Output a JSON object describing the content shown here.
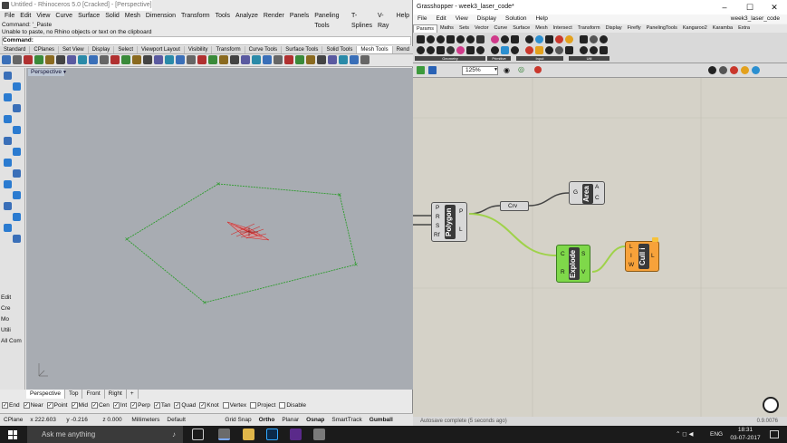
{
  "rhino": {
    "title": "Untitled - Rhinoceros 5.0 [Cracked] - [Perspective]",
    "menu": [
      "File",
      "Edit",
      "View",
      "Curve",
      "Surface",
      "Solid",
      "Mesh",
      "Dimension",
      "Transform",
      "Tools",
      "Analyze",
      "Render",
      "Panels",
      "Paneling Tools",
      "T-Splines",
      "V-Ray",
      "Help"
    ],
    "command_history": [
      "Command: '_Paste",
      "Unable to paste, no Rhino objects or text on the clipboard"
    ],
    "command_prompt": "Command:",
    "toolbar_tabs": [
      "Standard",
      "CPlanes",
      "Set View",
      "Display",
      "Select",
      "Viewport Layout",
      "Visibility",
      "Transform",
      "Curve Tools",
      "Surface Tools",
      "Solid Tools",
      "Mesh Tools",
      "Rend"
    ],
    "active_toolbar_tab": "Mesh Tools",
    "viewport_title": "Perspective",
    "sidebar_items": [
      "Edit",
      "Cre",
      "Mo",
      "Utili",
      "All Com"
    ],
    "viewport_tabs": [
      "Perspective",
      "Top",
      "Front",
      "Right",
      "+"
    ],
    "osnaps": [
      {
        "label": "End",
        "checked": true
      },
      {
        "label": "Near",
        "checked": true
      },
      {
        "label": "Point",
        "checked": true
      },
      {
        "label": "Mid",
        "checked": true
      },
      {
        "label": "Cen",
        "checked": true
      },
      {
        "label": "Int",
        "checked": true
      },
      {
        "label": "Perp",
        "checked": true
      },
      {
        "label": "Tan",
        "checked": true
      },
      {
        "label": "Quad",
        "checked": true
      },
      {
        "label": "Knot",
        "checked": true
      },
      {
        "label": "Vertex",
        "checked": false
      },
      {
        "label": "Project",
        "checked": false
      },
      {
        "label": "Disable",
        "checked": false
      }
    ],
    "status": {
      "cplane": "CPlane",
      "x": "x 222.603",
      "y": "y -0.216",
      "z": "z 0.000",
      "units": "Millimeters",
      "layer": "Default",
      "grid_snap": "Grid Snap",
      "ortho": "Ortho",
      "planar": "Planar",
      "osnap": "Osnap",
      "smarttrack": "SmartTrack",
      "gumball": "Gumball"
    },
    "colors": {
      "viewport_bg": "#a8acb2",
      "curve": "#2e9c2e",
      "grid": "#d22a2a"
    }
  },
  "grasshopper": {
    "title": "Grasshopper - week3_laser_code*",
    "menu": [
      "File",
      "Edit",
      "View",
      "Display",
      "Solution",
      "Help"
    ],
    "document": "week3_laser_code",
    "tabs": [
      "Params",
      "Maths",
      "Sets",
      "Vector",
      "Curve",
      "Surface",
      "Mesh",
      "Intersect",
      "Transform",
      "Display",
      "Firefly",
      "PanelingTools",
      "Kangaroo2",
      "Karamba",
      "Extra"
    ],
    "active_tab": "Params",
    "ribbon_groups": [
      "Geometry",
      "Primitive",
      "Input",
      "Util"
    ],
    "zoom": "125%",
    "components": {
      "polygon": {
        "name": "Polygon",
        "inputs": [
          "P",
          "R",
          "S",
          "Rf"
        ],
        "outputs": [
          "P",
          "L"
        ]
      },
      "crv": {
        "name": "Crv"
      },
      "area": {
        "name": "Area",
        "inputs": [
          "G"
        ],
        "outputs": [
          "A",
          "C"
        ]
      },
      "explode": {
        "name": "Explode",
        "inputs": [
          "C",
          "R"
        ],
        "outputs": [
          "S",
          "V"
        ]
      },
      "cull": {
        "name": "Cull i",
        "inputs": [
          "L",
          "I",
          "W"
        ],
        "outputs": [
          "L"
        ]
      }
    },
    "status": "Autosave complete (5 seconds ago)",
    "version": "0.9.0076"
  },
  "taskbar": {
    "search_placeholder": "Ask me anything",
    "language": "ENG",
    "time": "18:31",
    "date": "03-07-2017"
  }
}
